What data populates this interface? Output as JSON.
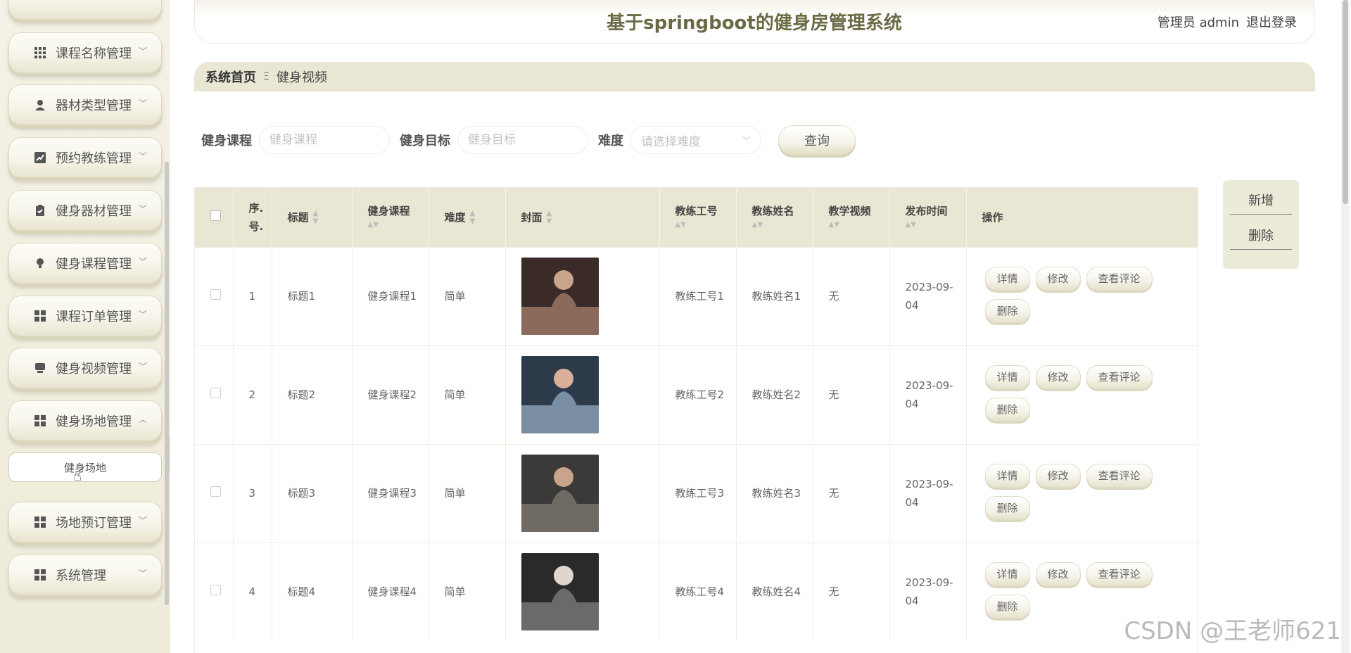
{
  "header": {
    "title": "基于springboot的健身房管理系统",
    "user": "管理员 admin",
    "logout": "退出登录"
  },
  "sidebar": {
    "items": [
      {
        "label": "课程名称管理",
        "icon": "grid-icon"
      },
      {
        "label": "器材类型管理",
        "icon": "user-icon"
      },
      {
        "label": "预约教练管理",
        "icon": "chart-icon"
      },
      {
        "label": "健身器材管理",
        "icon": "clipboard-check-icon"
      },
      {
        "label": "健身课程管理",
        "icon": "lightbulb-icon"
      },
      {
        "label": "课程订单管理",
        "icon": "apps-icon"
      },
      {
        "label": "健身视频管理",
        "icon": "inbox-icon"
      },
      {
        "label": "健身场地管理",
        "icon": "apps-icon"
      },
      {
        "label": "场地预订管理",
        "icon": "apps-icon"
      },
      {
        "label": "系统管理",
        "icon": "apps-icon"
      }
    ],
    "submenu": {
      "label": "健身场地"
    }
  },
  "breadcrumb": {
    "home": "系统首页",
    "separator": "Ξ",
    "current": "健身视频"
  },
  "search": {
    "course_label": "健身课程",
    "course_placeholder": "健身课程",
    "goal_label": "健身目标",
    "goal_placeholder": "健身目标",
    "difficulty_label": "难度",
    "difficulty_placeholder": "请选择难度",
    "query_button": "查询"
  },
  "actions": {
    "add": "新增",
    "delete": "删除"
  },
  "table": {
    "headers": {
      "index": "序.号.",
      "title": "标题",
      "course": "健身课程",
      "difficulty": "难度",
      "cover": "封面",
      "coach_id": "教练工号",
      "coach_name": "教练姓名",
      "video": "教学视频",
      "publish_time": "发布时间",
      "operation": "操作"
    },
    "row_buttons": {
      "detail": "详情",
      "edit": "修改",
      "comments": "查看评论",
      "delete": "删除"
    },
    "rows": [
      {
        "index": "1",
        "title": "标题1",
        "course": "健身课程1",
        "difficulty": "简单",
        "coach_id": "教练工号1",
        "coach_name": "教练姓名1",
        "video": "无",
        "publish_time": "2023-09-04"
      },
      {
        "index": "2",
        "title": "标题2",
        "course": "健身课程2",
        "difficulty": "简单",
        "coach_id": "教练工号2",
        "coach_name": "教练姓名2",
        "video": "无",
        "publish_time": "2023-09-04"
      },
      {
        "index": "3",
        "title": "标题3",
        "course": "健身课程3",
        "difficulty": "简单",
        "coach_id": "教练工号3",
        "coach_name": "教练姓名3",
        "video": "无",
        "publish_time": "2023-09-04"
      },
      {
        "index": "4",
        "title": "标题4",
        "course": "健身课程4",
        "difficulty": "简单",
        "coach_id": "教练工号4",
        "coach_name": "教练姓名4",
        "video": "无",
        "publish_time": "2023-09-04"
      }
    ]
  },
  "watermark": "CSDN @王老师621"
}
